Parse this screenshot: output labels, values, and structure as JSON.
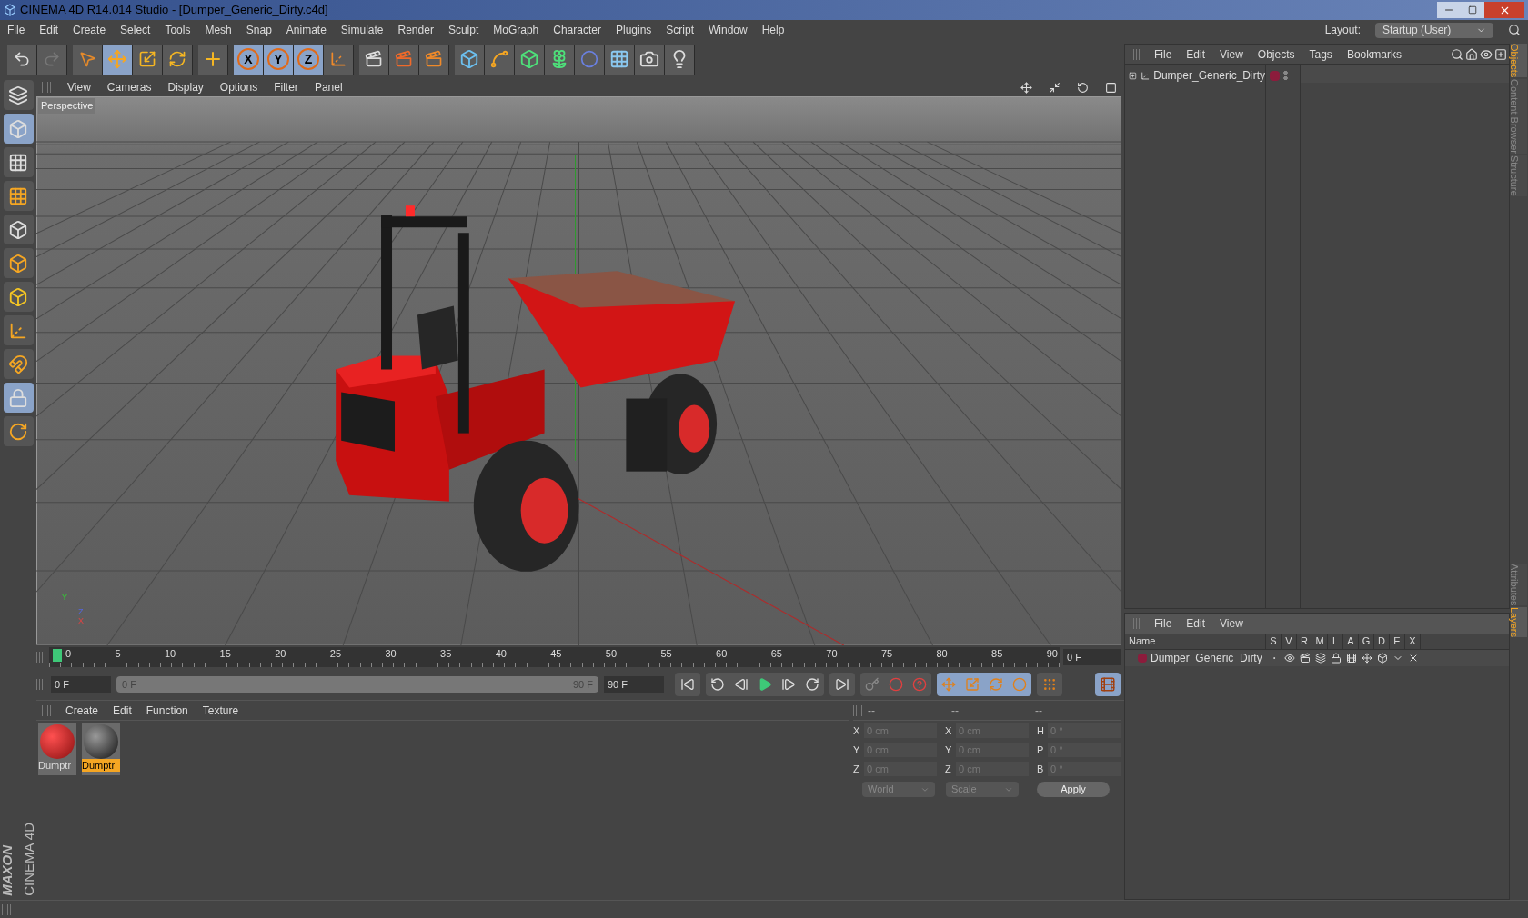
{
  "window": {
    "title": "CINEMA 4D R14.014 Studio - [Dumper_Generic_Dirty.c4d]"
  },
  "menu": [
    "File",
    "Edit",
    "Create",
    "Select",
    "Tools",
    "Mesh",
    "Snap",
    "Animate",
    "Simulate",
    "Render",
    "Sculpt",
    "MoGraph",
    "Character",
    "Plugins",
    "Script",
    "Window",
    "Help"
  ],
  "layout": {
    "label": "Layout:",
    "value": "Startup (User)"
  },
  "axis_buttons": [
    {
      "label": "X",
      "selected": true
    },
    {
      "label": "Y",
      "selected": true
    },
    {
      "label": "Z",
      "selected": true
    }
  ],
  "viewport": {
    "menu": [
      "View",
      "Cameras",
      "Display",
      "Options",
      "Filter",
      "Panel"
    ],
    "label": "Perspective",
    "axis_labels": [
      "Y",
      "Z",
      "X"
    ]
  },
  "timeline": {
    "ticks": [
      "0",
      "5",
      "10",
      "15",
      "20",
      "25",
      "30",
      "35",
      "40",
      "45",
      "50",
      "55",
      "60",
      "65",
      "70",
      "75",
      "80",
      "85",
      "90"
    ],
    "current": "0 F",
    "start": "0 F",
    "range_start": "0 F",
    "range_end": "90 F",
    "range_slider": {
      "level": 1
    },
    "end": "90 F"
  },
  "materials": {
    "menu": [
      "Create",
      "Edit",
      "Function",
      "Texture"
    ],
    "items": [
      {
        "name": "Dumptr",
        "selected": false,
        "kind": "red"
      },
      {
        "name": "Dumptr",
        "selected": true,
        "kind": "dark"
      }
    ]
  },
  "coords": {
    "headers": [
      "--",
      "--",
      "--"
    ],
    "rows": [
      {
        "a": "X",
        "a_value": "0 cm",
        "b": "X",
        "b_value": "0 cm",
        "c": "H",
        "c_value": "0 °"
      },
      {
        "a": "Y",
        "a_value": "0 cm",
        "b": "Y",
        "b_value": "0 cm",
        "c": "P",
        "c_value": "0 °"
      },
      {
        "a": "Z",
        "a_value": "0 cm",
        "b": "Z",
        "b_value": "0 cm",
        "c": "B",
        "c_value": "0 °"
      }
    ],
    "mode": "World",
    "transform": "Scale",
    "apply": "Apply"
  },
  "objects": {
    "menu": [
      "File",
      "Edit",
      "View",
      "Objects",
      "Tags",
      "Bookmarks"
    ],
    "items": [
      {
        "name": "Dumper_Generic_Dirty",
        "color": "#8c1c3c"
      }
    ]
  },
  "layers": {
    "menu": [
      "File",
      "Edit",
      "View"
    ],
    "columns": [
      "Name",
      "S",
      "V",
      "R",
      "M",
      "L",
      "A",
      "G",
      "D",
      "E",
      "X"
    ],
    "rows": [
      {
        "name": "Dumper_Generic_Dirty",
        "color": "#8c1c3c"
      }
    ]
  },
  "side_tabs_top": [
    {
      "label": "Objects",
      "selected": true
    },
    {
      "label": "Content Browser",
      "selected": false
    },
    {
      "label": "Structure",
      "selected": false
    }
  ],
  "side_tabs_bottom": [
    {
      "label": "Attributes",
      "selected": false
    },
    {
      "label": "Layers",
      "selected": true
    }
  ],
  "logo": {
    "brand": "MAXON",
    "product": "CINEMA 4D"
  }
}
